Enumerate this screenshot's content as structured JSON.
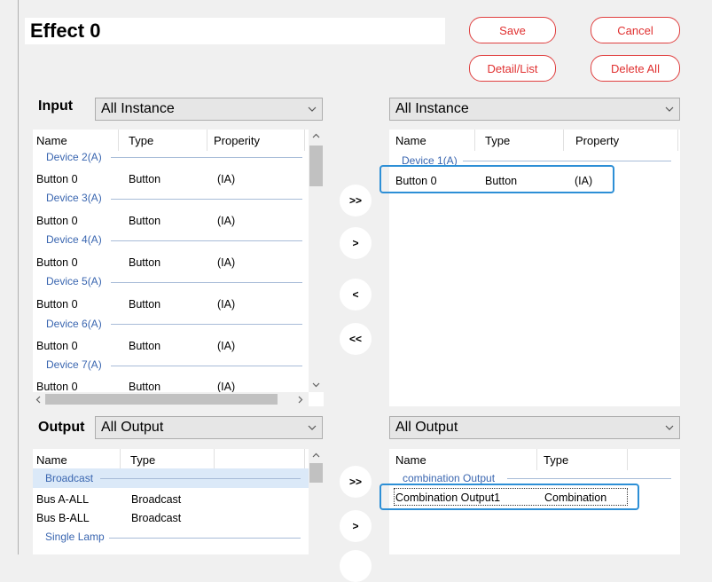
{
  "header": {
    "title": "Effect 0"
  },
  "buttons": {
    "save": "Save",
    "cancel": "Cancel",
    "detail_list": "Detail/List",
    "delete_all": "Delete All"
  },
  "input": {
    "label": "Input",
    "filter": "All Instance",
    "columns": [
      "Name",
      "Type",
      "Properity"
    ],
    "groups": [
      {
        "name": "Device 2(A)",
        "row": [
          "Button 0",
          "Button",
          "(IA)"
        ]
      },
      {
        "name": "Device 3(A)",
        "row": [
          "Button 0",
          "Button",
          "(IA)"
        ]
      },
      {
        "name": "Device 4(A)",
        "row": [
          "Button 0",
          "Button",
          "(IA)"
        ]
      },
      {
        "name": "Device 5(A)",
        "row": [
          "Button 0",
          "Button",
          "(IA)"
        ]
      },
      {
        "name": "Device 6(A)",
        "row": [
          "Button 0",
          "Button",
          "(IA)"
        ]
      },
      {
        "name": "Device 7(A)",
        "row": [
          "Button 0",
          "Button",
          "(IA)"
        ]
      }
    ]
  },
  "input_selected": {
    "filter": "All Instance",
    "columns": [
      "Name",
      "Type",
      "Property"
    ],
    "group": "Device 1(A)",
    "row": [
      "Button 0",
      "Button",
      "(IA)"
    ]
  },
  "transfer": {
    "add_all": ">>",
    "add": ">",
    "remove": "<",
    "remove_all": "<<"
  },
  "output": {
    "label": "Output",
    "filter": "All Output",
    "columns": [
      "Name",
      "Type"
    ],
    "group1": "Broadcast",
    "rows": [
      [
        "Bus A-ALL",
        "Broadcast"
      ],
      [
        "Bus B-ALL",
        "Broadcast"
      ]
    ],
    "group2": "Single Lamp"
  },
  "output_selected": {
    "filter": "All Output",
    "columns": [
      "Name",
      "Type"
    ],
    "group": "combination Output",
    "row": [
      "Combination Output1",
      "Combination"
    ]
  }
}
